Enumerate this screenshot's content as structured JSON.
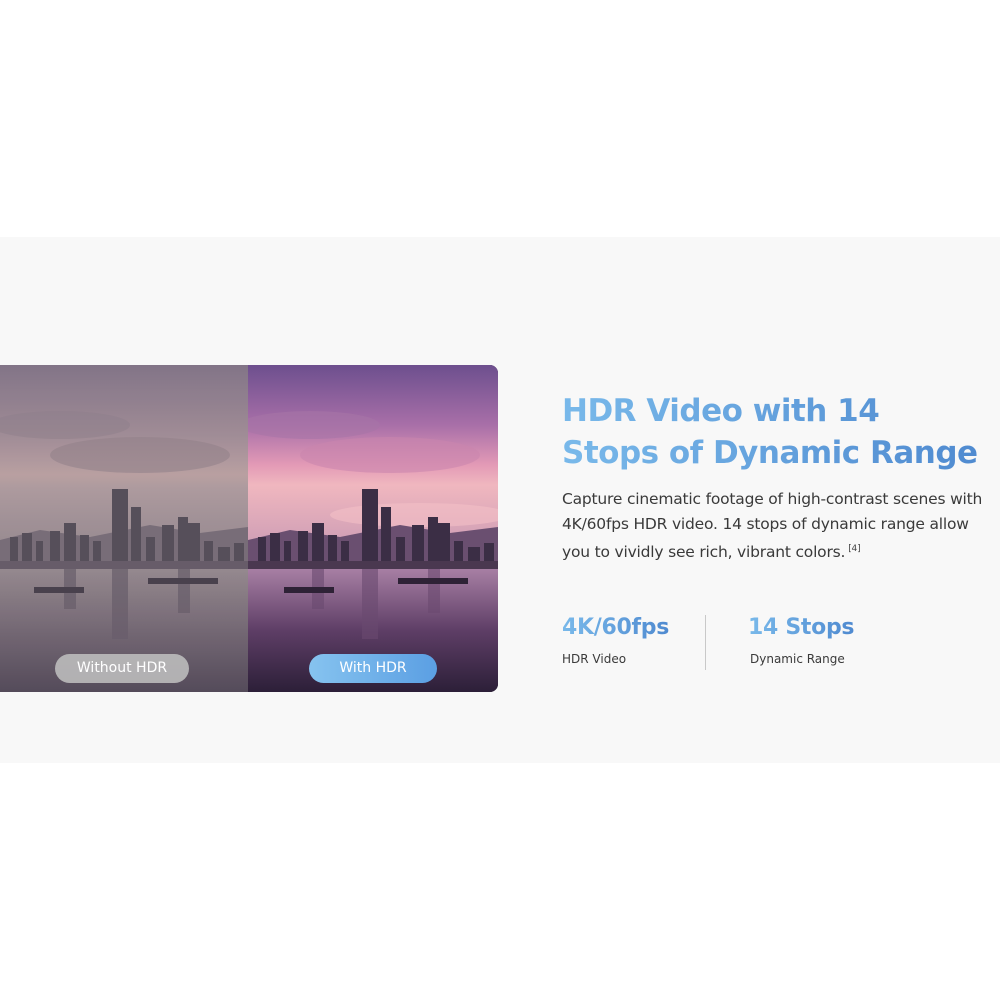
{
  "comparison": {
    "without_label": "Without HDR",
    "with_label": "With HDR"
  },
  "feature": {
    "title": "HDR Video with 14 Stops of Dynamic Range",
    "description": "Capture cinematic footage of high-contrast scenes with 4K/60fps HDR video. 14 stops of dynamic range allow you to vividly see rich, vibrant colors.",
    "footnote": "[4]"
  },
  "stats": [
    {
      "value": "4K/60fps",
      "caption": "HDR Video"
    },
    {
      "value": "14 Stops",
      "caption": "Dynamic Range"
    }
  ],
  "colors": {
    "accent_start": "#79b9ea",
    "accent_end": "#4f8ad0",
    "band_background": "#f8f8f8"
  }
}
